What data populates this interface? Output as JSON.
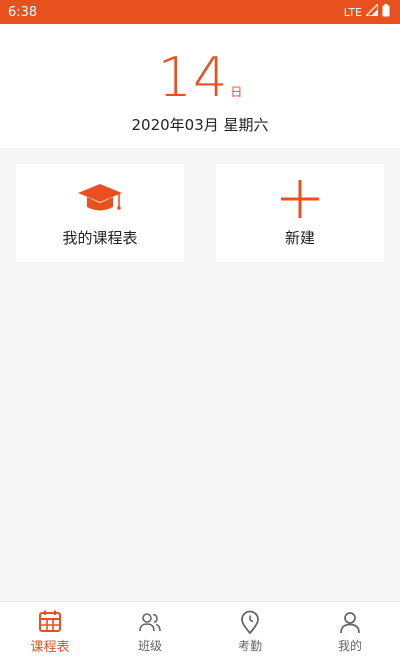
{
  "status": {
    "time": "6:38",
    "network": "LTE"
  },
  "header": {
    "day": "14",
    "day_suffix": "日",
    "date_line": "2020年03月 星期六"
  },
  "cards": [
    {
      "label": "我的课程表",
      "icon": "graduation-cap-icon"
    },
    {
      "label": "新建",
      "icon": "plus-icon"
    }
  ],
  "tabs": [
    {
      "label": "课程表",
      "icon": "calendar-icon",
      "active": true
    },
    {
      "label": "班级",
      "icon": "users-icon",
      "active": false
    },
    {
      "label": "考勤",
      "icon": "location-clock-icon",
      "active": false
    },
    {
      "label": "我的",
      "icon": "user-icon",
      "active": false
    }
  ],
  "colors": {
    "accent": "#e8511f",
    "tab_inactive": "#666666"
  }
}
